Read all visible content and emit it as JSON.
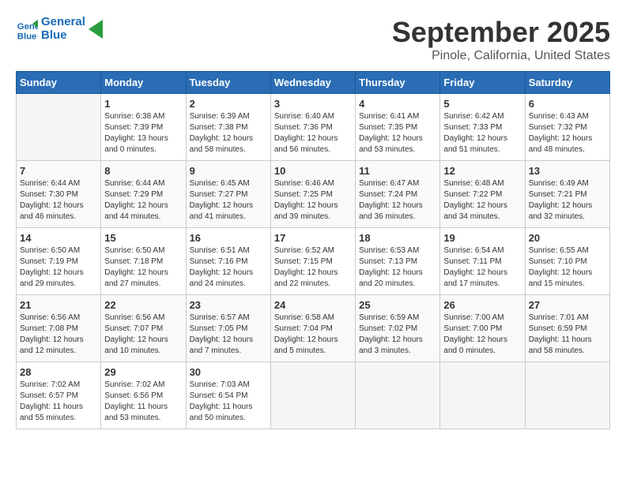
{
  "header": {
    "logo_line1": "General",
    "logo_line2": "Blue",
    "month": "September 2025",
    "location": "Pinole, California, United States"
  },
  "weekdays": [
    "Sunday",
    "Monday",
    "Tuesday",
    "Wednesday",
    "Thursday",
    "Friday",
    "Saturday"
  ],
  "weeks": [
    [
      {
        "day": "",
        "sunrise": "",
        "sunset": "",
        "daylight": ""
      },
      {
        "day": "1",
        "sunrise": "Sunrise: 6:38 AM",
        "sunset": "Sunset: 7:39 PM",
        "daylight": "Daylight: 13 hours and 0 minutes."
      },
      {
        "day": "2",
        "sunrise": "Sunrise: 6:39 AM",
        "sunset": "Sunset: 7:38 PM",
        "daylight": "Daylight: 12 hours and 58 minutes."
      },
      {
        "day": "3",
        "sunrise": "Sunrise: 6:40 AM",
        "sunset": "Sunset: 7:36 PM",
        "daylight": "Daylight: 12 hours and 56 minutes."
      },
      {
        "day": "4",
        "sunrise": "Sunrise: 6:41 AM",
        "sunset": "Sunset: 7:35 PM",
        "daylight": "Daylight: 12 hours and 53 minutes."
      },
      {
        "day": "5",
        "sunrise": "Sunrise: 6:42 AM",
        "sunset": "Sunset: 7:33 PM",
        "daylight": "Daylight: 12 hours and 51 minutes."
      },
      {
        "day": "6",
        "sunrise": "Sunrise: 6:43 AM",
        "sunset": "Sunset: 7:32 PM",
        "daylight": "Daylight: 12 hours and 48 minutes."
      }
    ],
    [
      {
        "day": "7",
        "sunrise": "Sunrise: 6:44 AM",
        "sunset": "Sunset: 7:30 PM",
        "daylight": "Daylight: 12 hours and 46 minutes."
      },
      {
        "day": "8",
        "sunrise": "Sunrise: 6:44 AM",
        "sunset": "Sunset: 7:29 PM",
        "daylight": "Daylight: 12 hours and 44 minutes."
      },
      {
        "day": "9",
        "sunrise": "Sunrise: 6:45 AM",
        "sunset": "Sunset: 7:27 PM",
        "daylight": "Daylight: 12 hours and 41 minutes."
      },
      {
        "day": "10",
        "sunrise": "Sunrise: 6:46 AM",
        "sunset": "Sunset: 7:25 PM",
        "daylight": "Daylight: 12 hours and 39 minutes."
      },
      {
        "day": "11",
        "sunrise": "Sunrise: 6:47 AM",
        "sunset": "Sunset: 7:24 PM",
        "daylight": "Daylight: 12 hours and 36 minutes."
      },
      {
        "day": "12",
        "sunrise": "Sunrise: 6:48 AM",
        "sunset": "Sunset: 7:22 PM",
        "daylight": "Daylight: 12 hours and 34 minutes."
      },
      {
        "day": "13",
        "sunrise": "Sunrise: 6:49 AM",
        "sunset": "Sunset: 7:21 PM",
        "daylight": "Daylight: 12 hours and 32 minutes."
      }
    ],
    [
      {
        "day": "14",
        "sunrise": "Sunrise: 6:50 AM",
        "sunset": "Sunset: 7:19 PM",
        "daylight": "Daylight: 12 hours and 29 minutes."
      },
      {
        "day": "15",
        "sunrise": "Sunrise: 6:50 AM",
        "sunset": "Sunset: 7:18 PM",
        "daylight": "Daylight: 12 hours and 27 minutes."
      },
      {
        "day": "16",
        "sunrise": "Sunrise: 6:51 AM",
        "sunset": "Sunset: 7:16 PM",
        "daylight": "Daylight: 12 hours and 24 minutes."
      },
      {
        "day": "17",
        "sunrise": "Sunrise: 6:52 AM",
        "sunset": "Sunset: 7:15 PM",
        "daylight": "Daylight: 12 hours and 22 minutes."
      },
      {
        "day": "18",
        "sunrise": "Sunrise: 6:53 AM",
        "sunset": "Sunset: 7:13 PM",
        "daylight": "Daylight: 12 hours and 20 minutes."
      },
      {
        "day": "19",
        "sunrise": "Sunrise: 6:54 AM",
        "sunset": "Sunset: 7:11 PM",
        "daylight": "Daylight: 12 hours and 17 minutes."
      },
      {
        "day": "20",
        "sunrise": "Sunrise: 6:55 AM",
        "sunset": "Sunset: 7:10 PM",
        "daylight": "Daylight: 12 hours and 15 minutes."
      }
    ],
    [
      {
        "day": "21",
        "sunrise": "Sunrise: 6:56 AM",
        "sunset": "Sunset: 7:08 PM",
        "daylight": "Daylight: 12 hours and 12 minutes."
      },
      {
        "day": "22",
        "sunrise": "Sunrise: 6:56 AM",
        "sunset": "Sunset: 7:07 PM",
        "daylight": "Daylight: 12 hours and 10 minutes."
      },
      {
        "day": "23",
        "sunrise": "Sunrise: 6:57 AM",
        "sunset": "Sunset: 7:05 PM",
        "daylight": "Daylight: 12 hours and 7 minutes."
      },
      {
        "day": "24",
        "sunrise": "Sunrise: 6:58 AM",
        "sunset": "Sunset: 7:04 PM",
        "daylight": "Daylight: 12 hours and 5 minutes."
      },
      {
        "day": "25",
        "sunrise": "Sunrise: 6:59 AM",
        "sunset": "Sunset: 7:02 PM",
        "daylight": "Daylight: 12 hours and 3 minutes."
      },
      {
        "day": "26",
        "sunrise": "Sunrise: 7:00 AM",
        "sunset": "Sunset: 7:00 PM",
        "daylight": "Daylight: 12 hours and 0 minutes."
      },
      {
        "day": "27",
        "sunrise": "Sunrise: 7:01 AM",
        "sunset": "Sunset: 6:59 PM",
        "daylight": "Daylight: 11 hours and 58 minutes."
      }
    ],
    [
      {
        "day": "28",
        "sunrise": "Sunrise: 7:02 AM",
        "sunset": "Sunset: 6:57 PM",
        "daylight": "Daylight: 11 hours and 55 minutes."
      },
      {
        "day": "29",
        "sunrise": "Sunrise: 7:02 AM",
        "sunset": "Sunset: 6:56 PM",
        "daylight": "Daylight: 11 hours and 53 minutes."
      },
      {
        "day": "30",
        "sunrise": "Sunrise: 7:03 AM",
        "sunset": "Sunset: 6:54 PM",
        "daylight": "Daylight: 11 hours and 50 minutes."
      },
      {
        "day": "",
        "sunrise": "",
        "sunset": "",
        "daylight": ""
      },
      {
        "day": "",
        "sunrise": "",
        "sunset": "",
        "daylight": ""
      },
      {
        "day": "",
        "sunrise": "",
        "sunset": "",
        "daylight": ""
      },
      {
        "day": "",
        "sunrise": "",
        "sunset": "",
        "daylight": ""
      }
    ]
  ]
}
